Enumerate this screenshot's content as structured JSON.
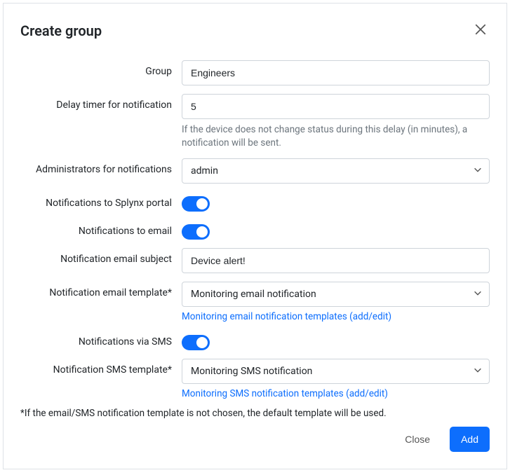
{
  "modal": {
    "title": "Create group",
    "footnote": "*If the email/SMS notification template is not chosen, the default template will be used."
  },
  "fields": {
    "group": {
      "label": "Group",
      "value": "Engineers"
    },
    "delay": {
      "label": "Delay timer for notification",
      "value": "5",
      "help": "If the device does not change status during this delay (in minutes), a notification will be sent."
    },
    "admins": {
      "label": "Administrators for notifications",
      "value": "admin"
    },
    "portal": {
      "label": "Notifications to Splynx portal",
      "on": true
    },
    "email": {
      "label": "Notifications to email",
      "on": true
    },
    "email_subject": {
      "label": "Notification email subject",
      "value": "Device alert!"
    },
    "email_template": {
      "label": "Notification email template*",
      "value": "Monitoring email notification",
      "link": "Monitoring email notification templates (add/edit)"
    },
    "sms": {
      "label": "Notifications via SMS",
      "on": true
    },
    "sms_template": {
      "label": "Notification SMS template*",
      "value": "Monitoring SMS notification",
      "link": "Monitoring SMS notification templates (add/edit)"
    }
  },
  "footer": {
    "close_label": "Close",
    "add_label": "Add"
  }
}
